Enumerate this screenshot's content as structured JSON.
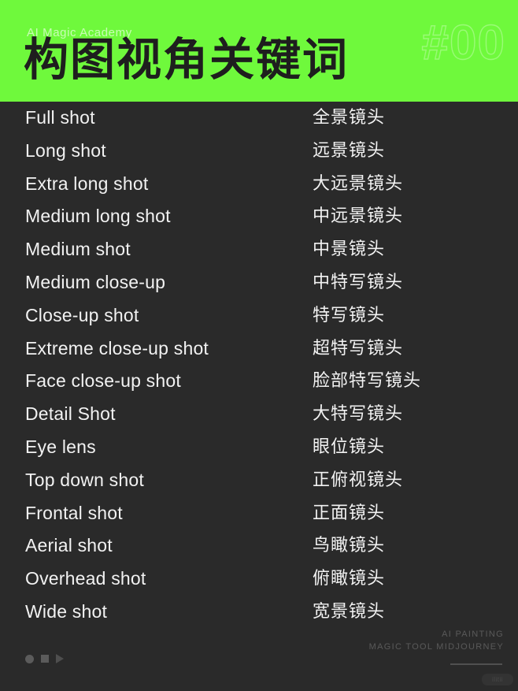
{
  "header": {
    "kicker": "AI Magic Academy",
    "title": "构图视角关键词",
    "number": "#00",
    "background_color": "#6ff93c",
    "title_color": "#1e1e1e"
  },
  "page": {
    "background_color": "#2a2a2a",
    "text_color": "#f2f2f2"
  },
  "list": {
    "rows": [
      {
        "en": "Full shot",
        "zh": "全景镜头"
      },
      {
        "en": "Long shot",
        "zh": "远景镜头"
      },
      {
        "en": "Extra long shot",
        "zh": "大远景镜头"
      },
      {
        "en": "Medium long shot",
        "zh": "中远景镜头"
      },
      {
        "en": "Medium shot",
        "zh": "中景镜头"
      },
      {
        "en": "Medium close-up",
        "zh": "中特写镜头"
      },
      {
        "en": "Close-up shot",
        "zh": "特写镜头"
      },
      {
        "en": "Extreme close-up shot",
        "zh": "超特写镜头"
      },
      {
        "en": "Face close-up shot",
        "zh": "脸部特写镜头"
      },
      {
        "en": "Detail Shot",
        "zh": "大特写镜头"
      },
      {
        "en": "Eye lens",
        "zh": "眼位镜头"
      },
      {
        "en": "Top down shot",
        "zh": "正俯视镜头"
      },
      {
        "en": "Frontal shot",
        "zh": "正面镜头"
      },
      {
        "en": "Aerial shot",
        "zh": "鸟瞰镜头"
      },
      {
        "en": "Overhead shot",
        "zh": "俯瞰镜头"
      },
      {
        "en": "Wide shot",
        "zh": "宽景镜头"
      }
    ]
  },
  "footer": {
    "brand_line1": "AI PAINTING",
    "brand_line2": "MAGIC TOOL MIDJOURNEY",
    "badge": "ilitii",
    "controls": [
      "record-dot",
      "stop-square",
      "play-triangle"
    ]
  }
}
